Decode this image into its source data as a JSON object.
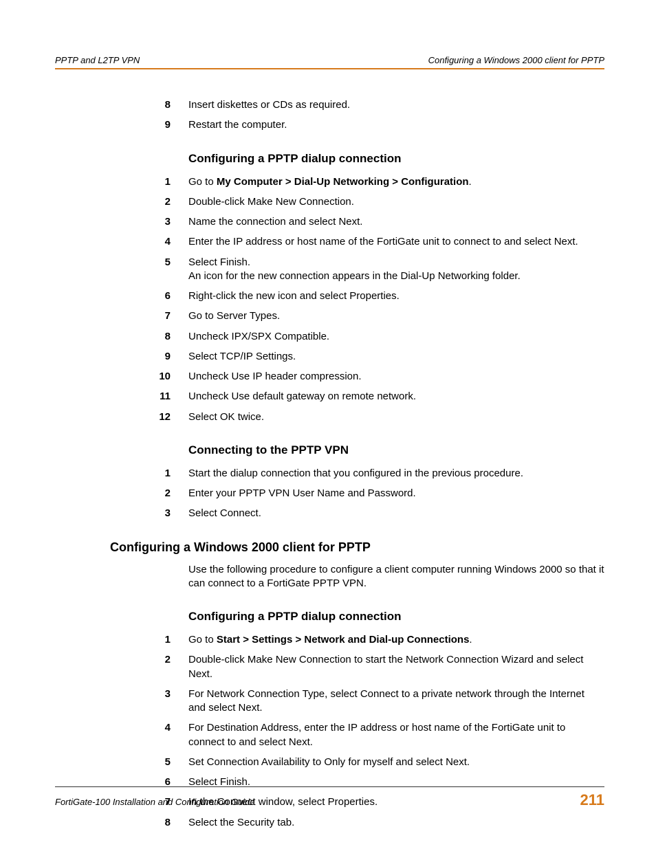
{
  "header": {
    "left": "PPTP and L2TP VPN",
    "right": "Configuring a Windows 2000 client for PPTP"
  },
  "initial_steps": [
    {
      "num": "8",
      "text": "Insert diskettes or CDs as required."
    },
    {
      "num": "9",
      "text": "Restart the computer."
    }
  ],
  "section1": {
    "heading": "Configuring a PPTP dialup connection",
    "steps": [
      {
        "num": "1",
        "prefix": "Go to ",
        "bold": "My Computer > Dial-Up Networking > Configuration",
        "suffix": "."
      },
      {
        "num": "2",
        "text": "Double-click Make New Connection."
      },
      {
        "num": "3",
        "text": "Name the connection and select Next."
      },
      {
        "num": "4",
        "text": "Enter the IP address or host name of the FortiGate unit to connect to and select Next."
      },
      {
        "num": "5",
        "text": "Select Finish.",
        "text2": "An icon for the new connection appears in the Dial-Up Networking folder."
      },
      {
        "num": "6",
        "text": "Right-click the new icon and select Properties."
      },
      {
        "num": "7",
        "text": "Go to Server Types."
      },
      {
        "num": "8",
        "text": "Uncheck IPX/SPX Compatible."
      },
      {
        "num": "9",
        "text": "Select TCP/IP Settings."
      },
      {
        "num": "10",
        "text": "Uncheck Use IP header compression."
      },
      {
        "num": "11",
        "text": "Uncheck Use default gateway on remote network."
      },
      {
        "num": "12",
        "text": "Select OK twice."
      }
    ]
  },
  "section2": {
    "heading": "Connecting to the PPTP VPN",
    "steps": [
      {
        "num": "1",
        "text": "Start the dialup connection that you configured in the previous procedure."
      },
      {
        "num": "2",
        "text": "Enter your PPTP VPN User Name and Password."
      },
      {
        "num": "3",
        "text": "Select Connect."
      }
    ]
  },
  "section3": {
    "heading": "Configuring a Windows 2000 client for PPTP",
    "intro": "Use the following procedure to configure a client computer running Windows 2000 so that it can connect to a FortiGate PPTP VPN."
  },
  "section4": {
    "heading": "Configuring a PPTP dialup connection",
    "steps": [
      {
        "num": "1",
        "prefix": "Go to ",
        "bold": "Start > Settings > Network and Dial-up Connections",
        "suffix": "."
      },
      {
        "num": "2",
        "text": "Double-click Make New Connection to start the Network Connection Wizard and select Next."
      },
      {
        "num": "3",
        "text": "For Network Connection Type, select Connect to a private network through the Internet and select Next."
      },
      {
        "num": "4",
        "text": "For Destination Address, enter the IP address or host name of the FortiGate unit to connect to and select Next."
      },
      {
        "num": "5",
        "text": "Set Connection Availability to Only for myself and select Next."
      },
      {
        "num": "6",
        "text": "Select Finish."
      },
      {
        "num": "7",
        "text": "In the Connect window, select Properties."
      },
      {
        "num": "8",
        "text": "Select the Security tab."
      }
    ]
  },
  "footer": {
    "left": "FortiGate-100 Installation and Configuration Guide",
    "right": "211"
  }
}
